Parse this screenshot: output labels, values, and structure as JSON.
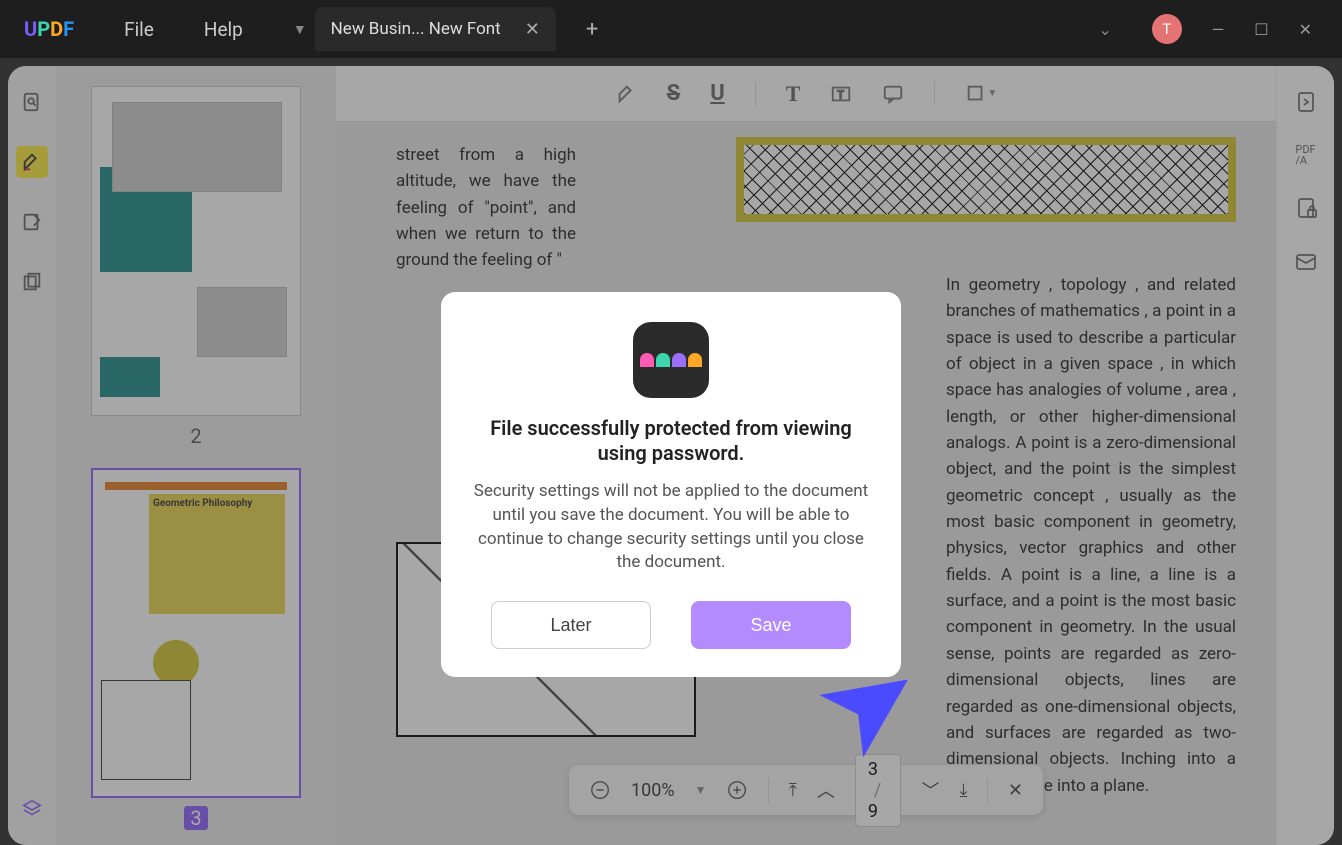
{
  "app": {
    "logo_parts": [
      "U",
      "P",
      "D",
      "F"
    ],
    "menu": {
      "file": "File",
      "help": "Help"
    },
    "tab_title": "New Busin... New Font",
    "avatar_letter": "T"
  },
  "thumbnails": {
    "page2_num": "2",
    "page3_num": "3",
    "page3_title": "Geometric\nPhilosophy"
  },
  "doc": {
    "para1": "street from a high altitude, we have the feeling of \"point\", and when we return to the ground  the feeling of \"",
    "para2": "In geometry , topology , and related branches of mathematics , a point in a space is used to describe a particular of object in a given space , in which space has analogies of volume , area , length, or other higher-dimensional analogs. A point is a zero-dimensional object, and the point is the simplest geometric concept , usually as the most basic component in geometry, physics, vector graphics and other fields. A point is a line, a line is a surface, and a point is the most basic component in geometry. In the usual sense, points are regarded as zero-dimensional objects, lines are regarded as one-dimensional objects, and surfaces are regarded as two-dimensional objects. Inching into a line, and a line into a plane."
  },
  "nav": {
    "zoom": "100%",
    "page_current": "3",
    "page_sep": "/",
    "page_total": "9"
  },
  "dialog": {
    "title": "File successfully protected from viewing using password.",
    "body": "Security settings will not be applied to the document until you save the document. You will be able to continue to change security settings until you close the document.",
    "later": "Later",
    "save": "Save"
  }
}
